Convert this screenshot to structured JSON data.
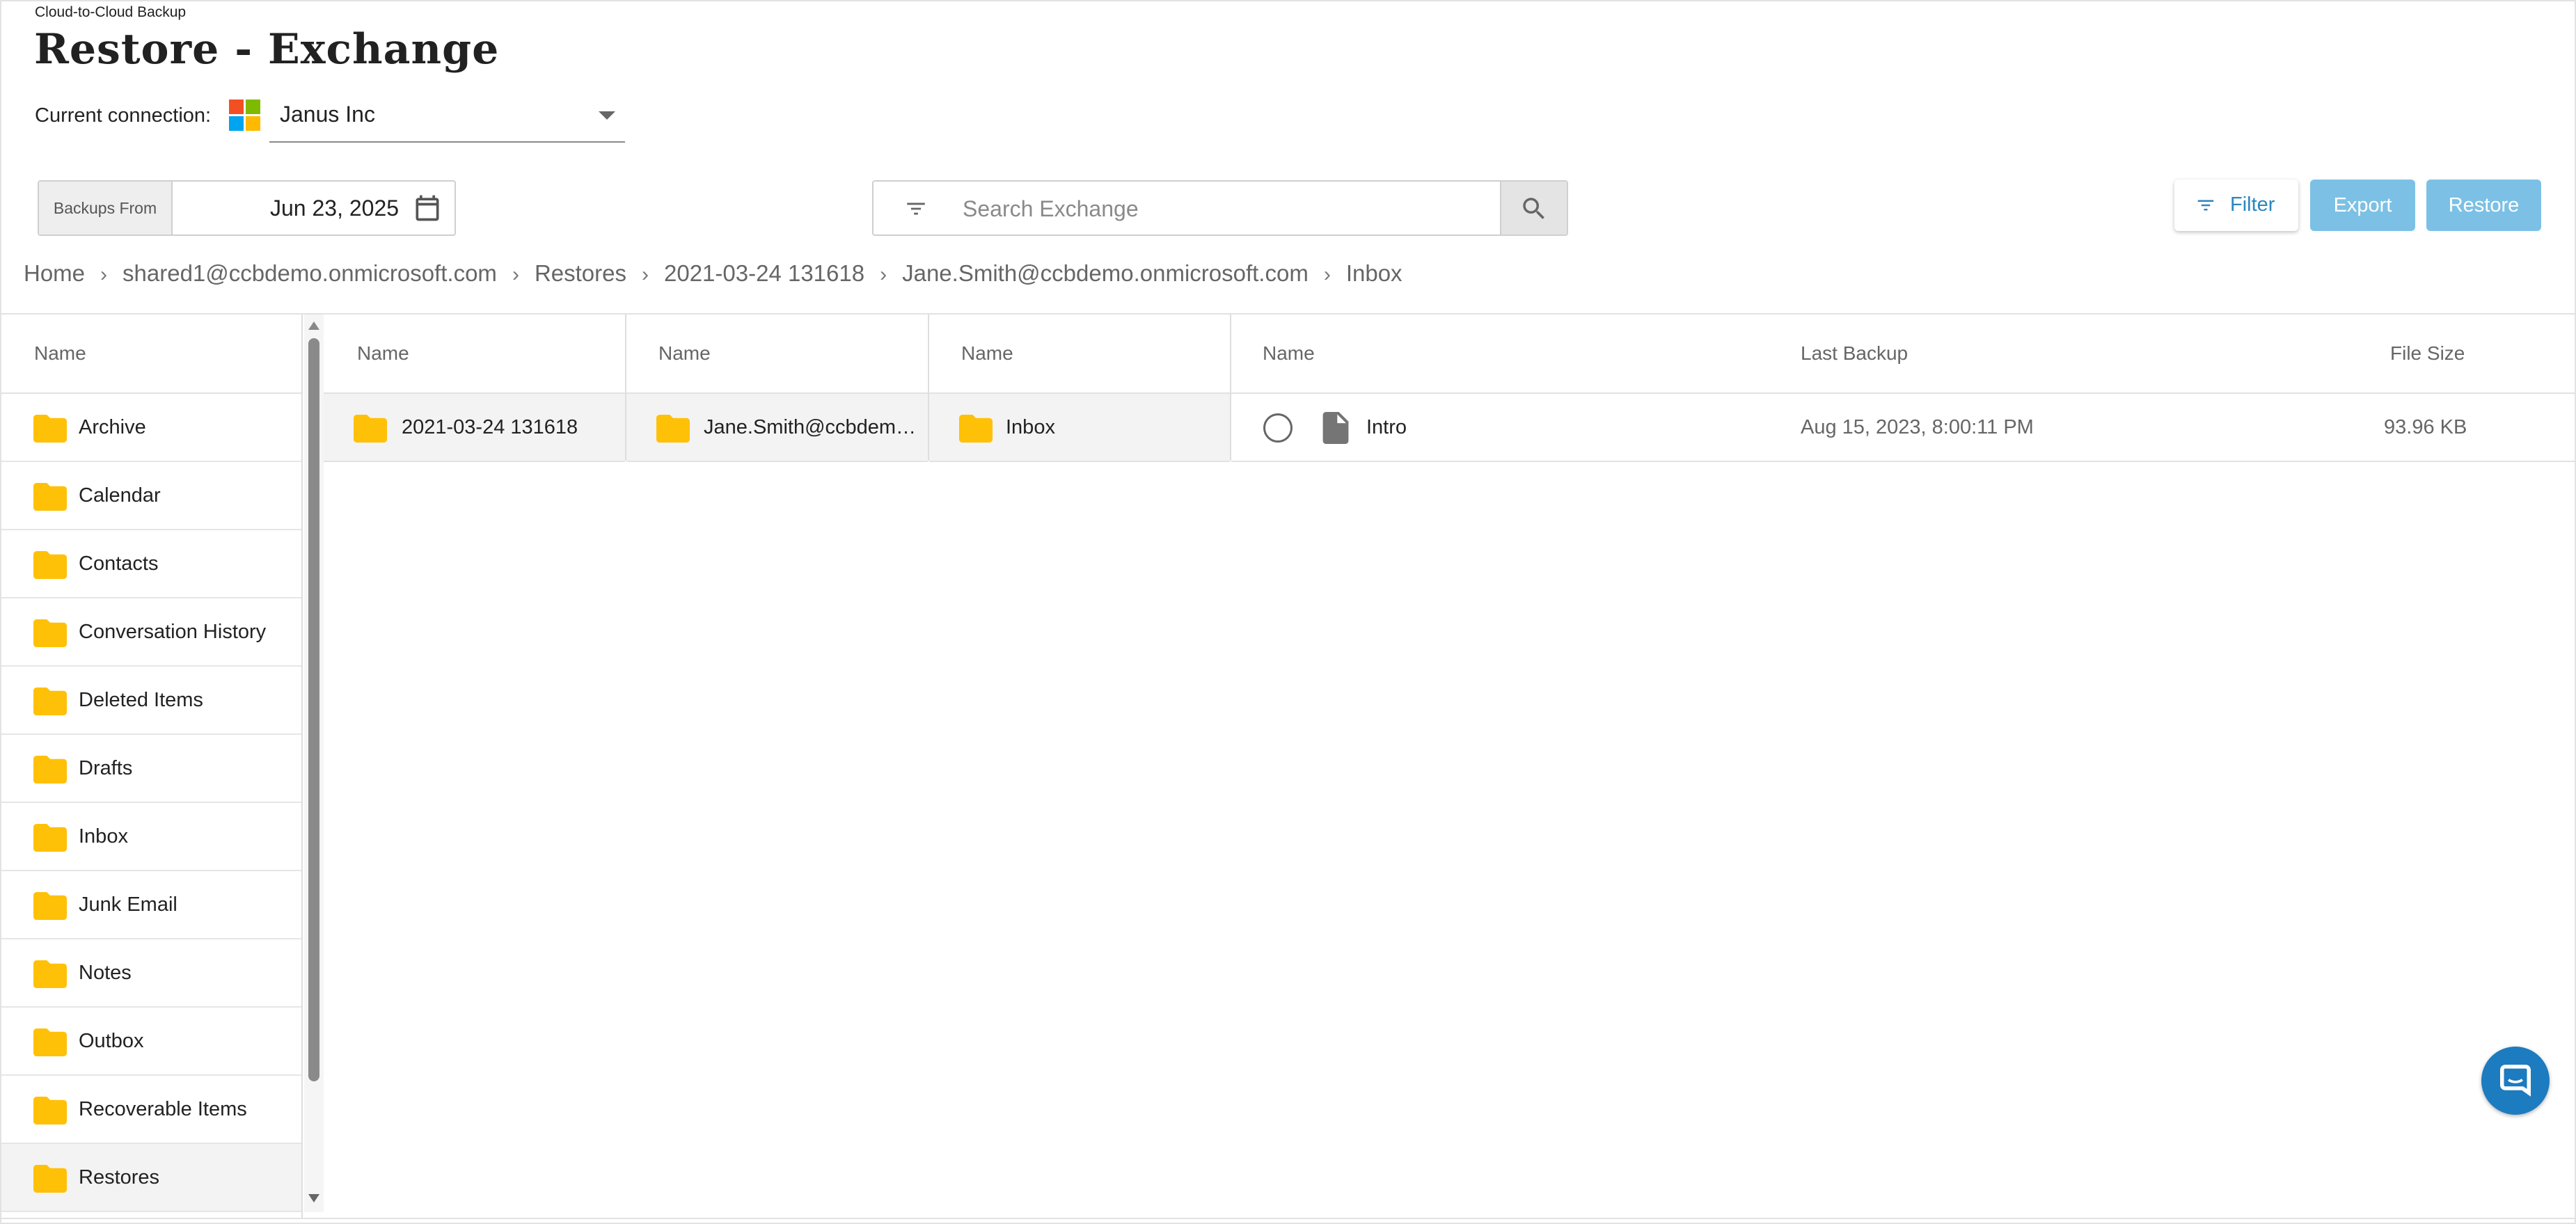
{
  "app": {
    "label": "Cloud-to-Cloud Backup",
    "title": "Restore - Exchange"
  },
  "connection": {
    "label": "Current connection:",
    "value": "Janus Inc",
    "logo_colors": [
      "#f25022",
      "#7fba00",
      "#00a4ef",
      "#ffb900"
    ]
  },
  "backups_from": {
    "label": "Backups From",
    "date": "Jun 23, 2025",
    "icon": "calendar-icon"
  },
  "search": {
    "placeholder": "Search Exchange",
    "filter_icon": "filter-list-icon",
    "search_icon": "search-icon"
  },
  "toolbar": {
    "filter_label": "Filter",
    "export_label": "Export",
    "restore_label": "Restore",
    "accent": "#2a86c0",
    "disabled_bg": "#7cc1e5"
  },
  "breadcrumb": [
    "Home",
    "shared1@ccbdemo.onmicrosoft.com",
    "Restores",
    "2021-03-24 131618",
    "Jane.Smith@ccbdemo.onmicrosoft.com",
    "Inbox"
  ],
  "folder_column": {
    "header": "Name",
    "items": [
      "Archive",
      "Calendar",
      "Contacts",
      "Conversation History",
      "Deleted Items",
      "Drafts",
      "Inbox",
      "Junk Email",
      "Notes",
      "Outbox",
      "Recoverable Items",
      "Restores"
    ],
    "selected": "Restores"
  },
  "column2": {
    "header": "Name",
    "item": "2021-03-24 131618"
  },
  "column3": {
    "header": "Name",
    "item": "Jane.Smith@ccbdem…"
  },
  "column4": {
    "header": "Name",
    "item": "Inbox"
  },
  "files": {
    "headers": {
      "name": "Name",
      "last_backup": "Last Backup",
      "file_size": "File Size"
    },
    "rows": [
      {
        "name": "Intro",
        "last_backup": "Aug 15, 2023, 8:00:11 PM",
        "file_size": "93.96 KB"
      }
    ]
  },
  "folder_color": "#ffc107"
}
